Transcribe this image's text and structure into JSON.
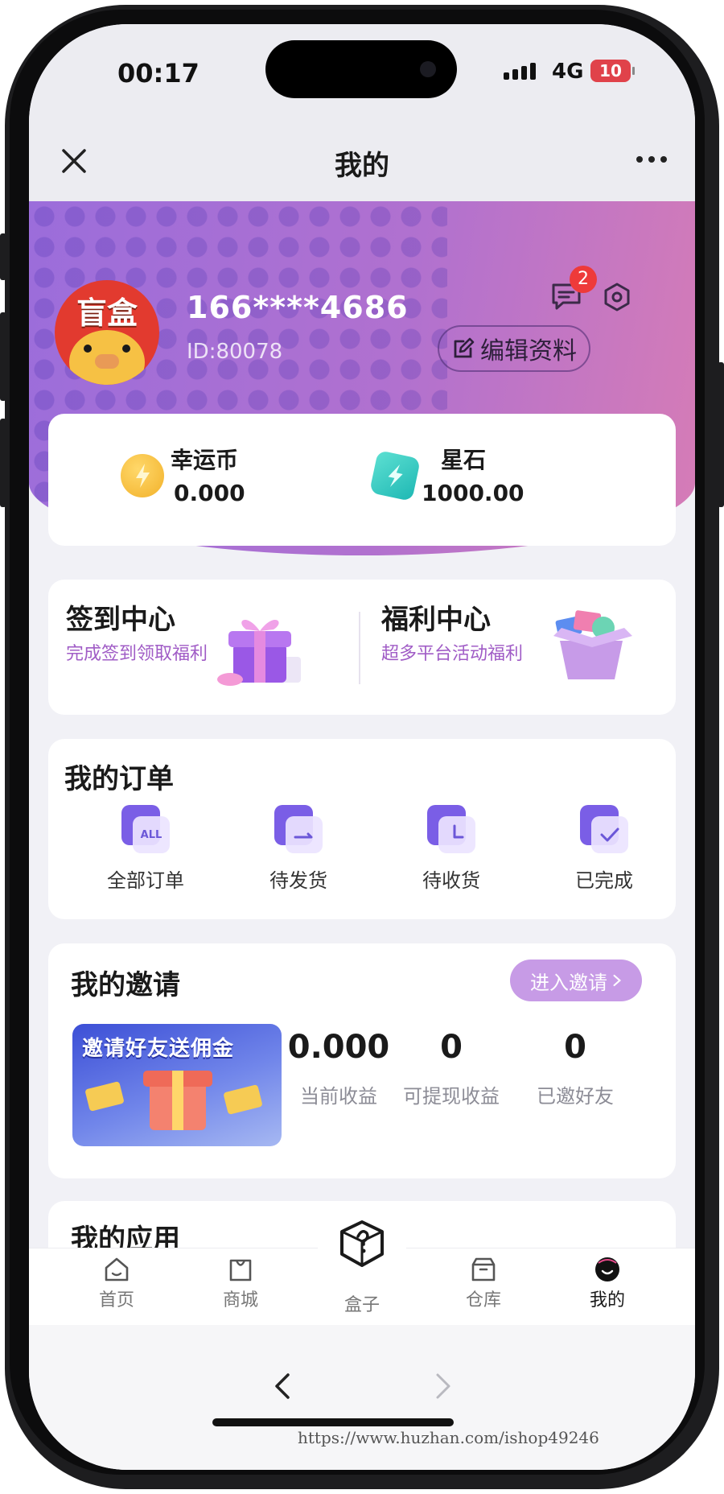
{
  "status_bar": {
    "time": "00:17",
    "network": "4G",
    "battery": "10"
  },
  "nav": {
    "title": "我的",
    "close_icon": "close-icon",
    "more_icon": "more-icon"
  },
  "profile": {
    "avatar_text": "盲盒",
    "phone": "166****4686",
    "id": "ID:80078",
    "message_count": "2",
    "edit_label": "编辑资料"
  },
  "wallet": {
    "coin_label": "幸运币",
    "coin_value": "0.000",
    "star_label": "星石",
    "star_value": "1000.00"
  },
  "centers": {
    "signin_title": "签到中心",
    "signin_sub": "完成签到领取福利",
    "welfare_title": "福利中心",
    "welfare_sub": "超多平台活动福利"
  },
  "orders": {
    "title": "我的订单",
    "items": [
      {
        "label": "全部订单",
        "icon": "all-orders-icon",
        "badge": "ALL"
      },
      {
        "label": "待发货",
        "icon": "to-ship-icon"
      },
      {
        "label": "待收货",
        "icon": "to-receive-icon"
      },
      {
        "label": "已完成",
        "icon": "completed-icon"
      }
    ]
  },
  "invite": {
    "title": "我的邀请",
    "button": "进入邀请",
    "banner_text": "邀请好友送佣金",
    "stats": [
      {
        "value": "0.000",
        "label": "当前收益"
      },
      {
        "value": "0",
        "label": "可提现收益"
      },
      {
        "value": "0",
        "label": "已邀好友"
      }
    ]
  },
  "apps": {
    "title": "我的应用"
  },
  "tabbar": {
    "items": [
      {
        "label": "首页",
        "icon": "home-icon"
      },
      {
        "label": "商城",
        "icon": "shop-icon"
      },
      {
        "label": "盒子",
        "icon": "mystery-box-icon"
      },
      {
        "label": "仓库",
        "icon": "warehouse-icon"
      },
      {
        "label": "我的",
        "icon": "profile-icon"
      }
    ]
  },
  "watermark": "https://www.huzhan.com/ishop49246",
  "colors": {
    "accent": "#a05cc6",
    "hero_start": "#9b6ddb",
    "hero_end": "#d67cb6",
    "badge": "#ee3a3a"
  }
}
